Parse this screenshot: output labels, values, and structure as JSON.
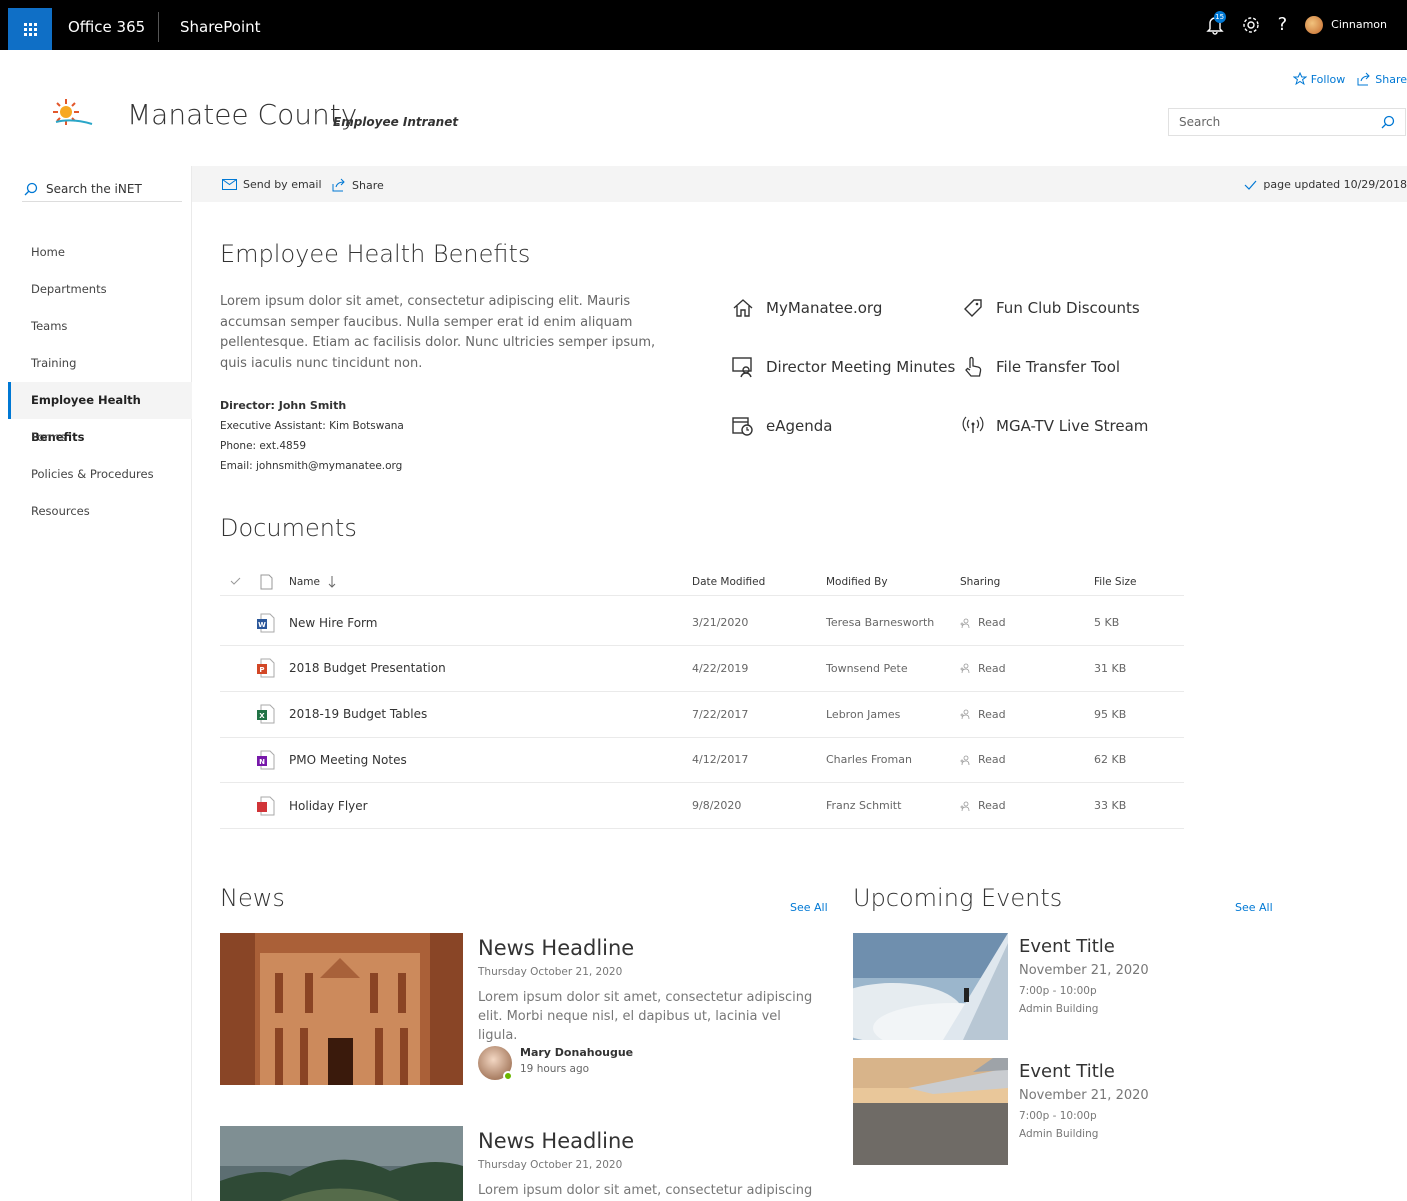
{
  "suite": {
    "brand": "Office 365",
    "app": "SharePoint",
    "notification_count": "15",
    "user_name": "Cinnamon"
  },
  "site": {
    "title": "Manatee County",
    "subtitle": "Employee Intranet",
    "follow_label": "Follow",
    "share_label": "Share",
    "search_placeholder": "Search"
  },
  "nav": {
    "search_label": "Search the iNET",
    "items": [
      {
        "label": "Home"
      },
      {
        "label": "Departments"
      },
      {
        "label": "Teams"
      },
      {
        "label": "Training"
      },
      {
        "label": "Employee Health Benefits",
        "active": true
      },
      {
        "label": "Forms"
      },
      {
        "label": "Policies & Procedures"
      },
      {
        "label": "Resources"
      }
    ]
  },
  "commandbar": {
    "send_email": "Send by email",
    "share": "Share",
    "updated": "page updated 10/29/2018"
  },
  "page": {
    "title": "Employee Health Benefits",
    "intro": "Lorem ipsum dolor sit amet, consectetur adipiscing elit. Mauris accumsan semper faucibus. Nulla semper erat id enim aliquam pellentesque. Etiam ac facilisis dolor. Nunc ultricies semper ipsum, quis iaculis nunc tincidunt non.",
    "director": "Director: John Smith",
    "assistant": "Executive Assistant: Kim Botswana",
    "phone": "Phone: ext.4859",
    "email": "Email: johnsmith@mymanatee.org"
  },
  "quicklinks": [
    {
      "label": "MyManatee.org",
      "icon": "home-icon"
    },
    {
      "label": "Fun Club Discounts",
      "icon": "tag-icon"
    },
    {
      "label": "Director Meeting Minutes",
      "icon": "presenter-icon"
    },
    {
      "label": "File Transfer Tool",
      "icon": "hand-pointer-icon"
    },
    {
      "label": "eAgenda",
      "icon": "calendar-clock-icon"
    },
    {
      "label": "MGA-TV Live Stream",
      "icon": "broadcast-icon"
    }
  ],
  "documents": {
    "title": "Documents",
    "headers": {
      "name": "Name",
      "date": "Date Modified",
      "by": "Modified By",
      "sharing": "Sharing",
      "size": "File Size"
    },
    "rows": [
      {
        "name": "New Hire Form",
        "type": "word",
        "date": "3/21/2020",
        "by": "Teresa Barnesworth",
        "sharing": "Read",
        "size": "5 KB"
      },
      {
        "name": "2018 Budget Presentation",
        "type": "powerpoint",
        "date": "4/22/2019",
        "by": "Townsend Pete",
        "sharing": "Read",
        "size": "31 KB"
      },
      {
        "name": "2018-19 Budget Tables",
        "type": "excel",
        "date": "7/22/2017",
        "by": "Lebron James",
        "sharing": "Read",
        "size": "95 KB"
      },
      {
        "name": "PMO Meeting Notes",
        "type": "onenote",
        "date": "4/12/2017",
        "by": "Charles Froman",
        "sharing": "Read",
        "size": "62 KB"
      },
      {
        "name": "Holiday Flyer",
        "type": "pdf",
        "date": "9/8/2020",
        "by": "Franz Schmitt",
        "sharing": "Read",
        "size": "33 KB"
      }
    ],
    "colors": {
      "word": "#2b579a",
      "powerpoint": "#d24726",
      "excel": "#217346",
      "onenote": "#7719aa",
      "pdf": "#d13438"
    }
  },
  "news": {
    "title": "News",
    "see_all": "See All",
    "items": [
      {
        "headline": "News Headline",
        "date": "Thursday October 21, 2020",
        "body": "Lorem ipsum dolor sit amet, consectetur adipiscing elit. Morbi neque nisl, el dapibus ut, lacinia vel ligula.",
        "author": "Mary Donahougue",
        "ago": "19 hours ago"
      },
      {
        "headline": "News Headline",
        "date": "Thursday October 21, 2020",
        "body": "Lorem ipsum dolor sit amet, consectetur adipiscing"
      }
    ]
  },
  "events": {
    "title": "Upcoming Events",
    "see_all": "See All",
    "items": [
      {
        "title": "Event Title",
        "date": "November 21, 2020",
        "time": "7:00p - 10:00p",
        "location": "Admin Building"
      },
      {
        "title": "Event Title",
        "date": "November 21, 2020",
        "time": "7:00p - 10:00p",
        "location": "Admin Building"
      }
    ]
  }
}
